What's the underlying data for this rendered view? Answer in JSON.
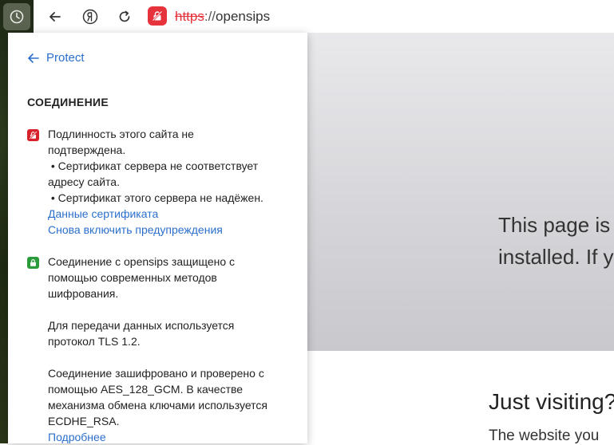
{
  "toolbar": {
    "url_scheme": "https",
    "url_separator": "://",
    "url_host": "opensips"
  },
  "background_page": {
    "hero_line1": "This page is",
    "hero_line2": "installed. If y",
    "visiting_heading": "Just visiting?",
    "visiting_text": "The website you"
  },
  "panel": {
    "back_label": "Protect",
    "section_title": "СОЕДИНЕНИЕ",
    "warning": {
      "line1": "Подлинность этого сайта не",
      "line2": "подтверждена.",
      "bullet1_line1": " • Сертификат сервера не соответствует",
      "bullet1_line2": "адресу сайта.",
      "bullet2": " • Сертификат этого сервера не надёжен.",
      "link_certificate": "Данные сертификата",
      "link_reenable": "Снова включить предупреждения"
    },
    "secure": {
      "line1": "Соединение с opensips защищено с",
      "line2": "помощью современных методов",
      "line3": "шифрования.",
      "tls_line1": "Для передачи данных используется",
      "tls_line2": "протокол TLS 1.2.",
      "cipher_line1": "Соединение зашифровано и проверено с",
      "cipher_line2": "помощью AES_128_GCM. В качестве",
      "cipher_line3": "механизма обмена ключами используется",
      "cipher_line4": "ECDHE_RSA.",
      "more_link": "Подробнее"
    }
  },
  "colors": {
    "link": "#2b6fcc",
    "danger": "#d8202a",
    "secure": "#2a9d3a",
    "url_warning": "#e5323b"
  },
  "icons": [
    "history-icon",
    "back-arrow-icon",
    "yandex-icon",
    "reload-icon",
    "broken-lock-icon",
    "lock-icon"
  ]
}
